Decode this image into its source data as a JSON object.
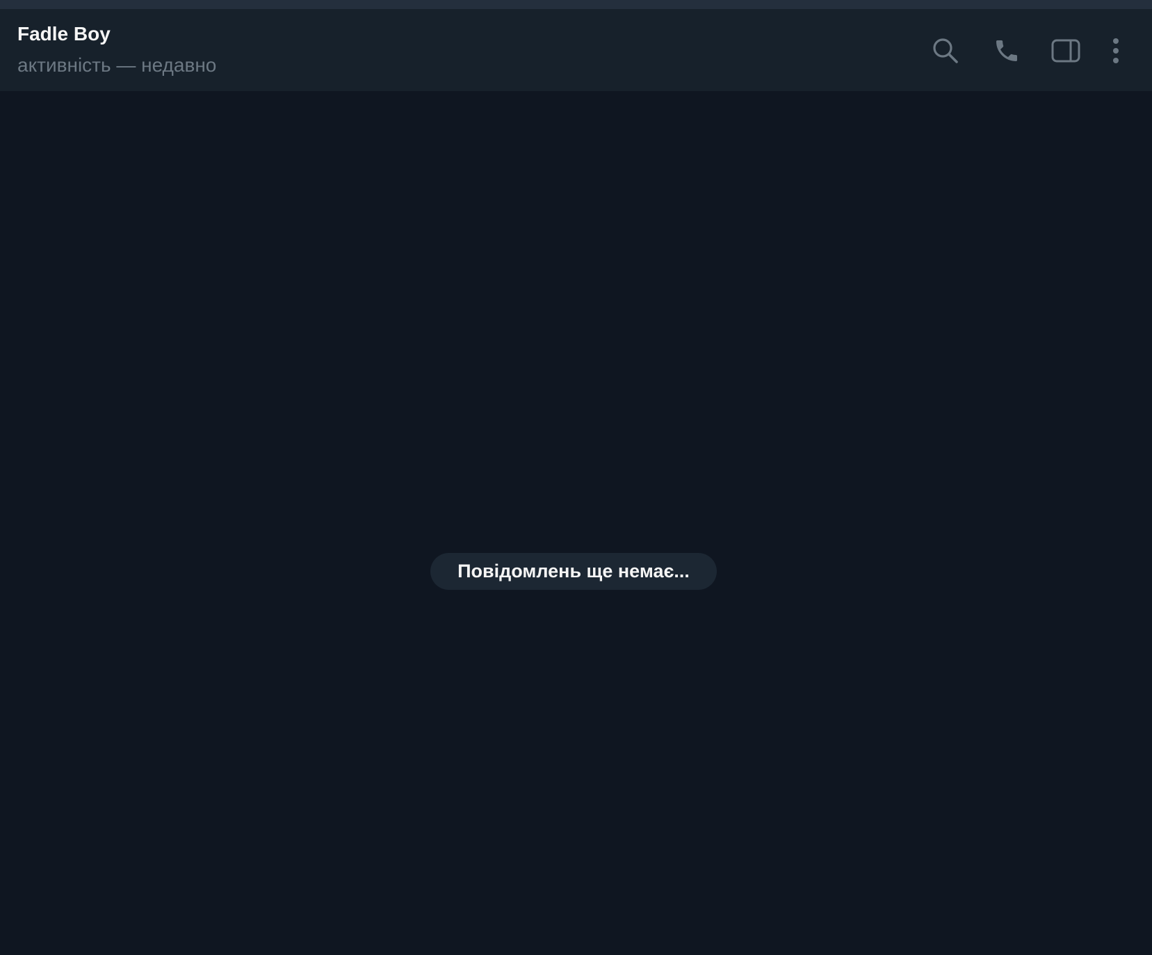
{
  "header": {
    "peer_name": "Fadle Boy",
    "peer_status": "активність — недавно",
    "icons": [
      "search-icon",
      "phone-icon",
      "sidebar-panel-icon",
      "more-vertical-icon"
    ]
  },
  "chat": {
    "empty_text": "Повідомлень ще немає..."
  },
  "colors": {
    "background": "#0f1621",
    "header_background": "#17212b",
    "pill_background": "#1c2733",
    "title_text": "#f5f5f5",
    "status_text": "#6c7883",
    "icon": "#6c7883"
  }
}
